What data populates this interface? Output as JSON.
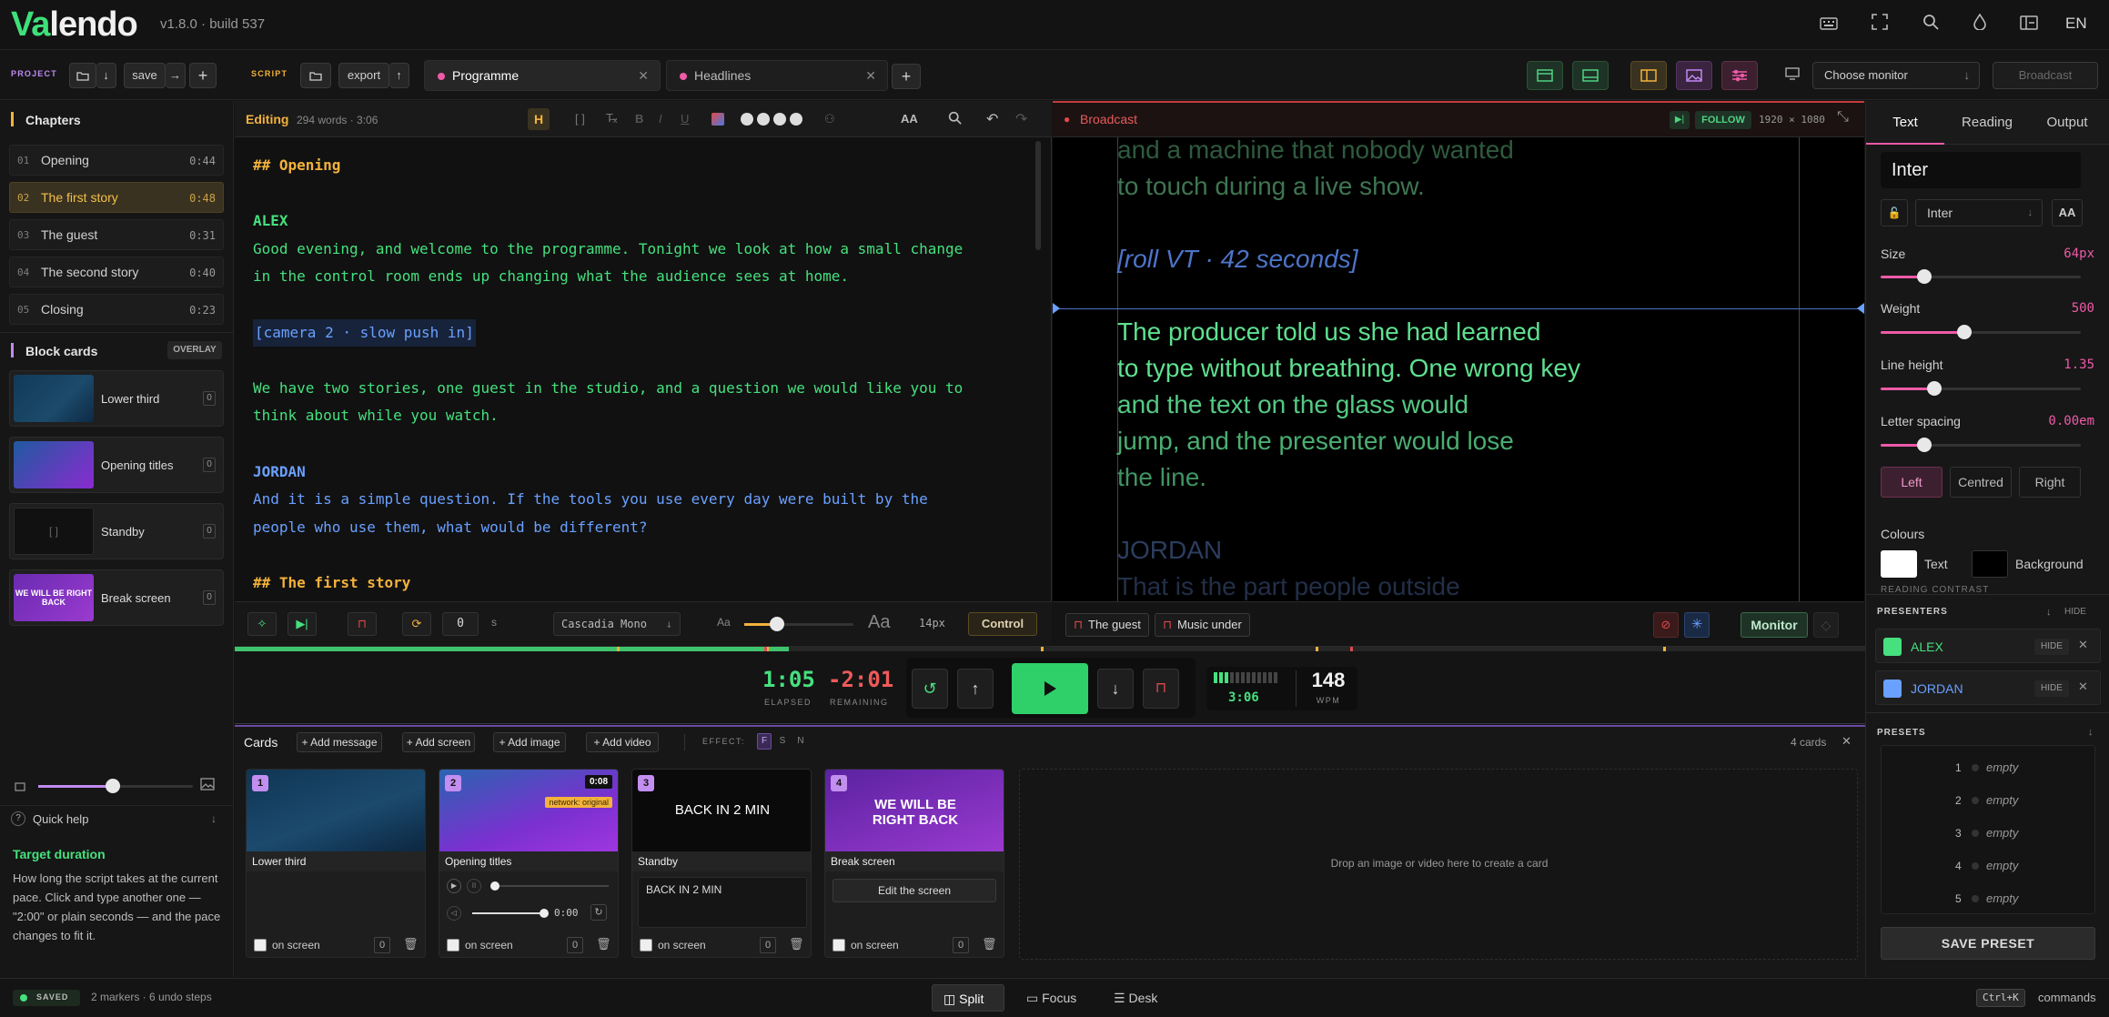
{
  "app": {
    "logo_a": "Va",
    "logo_b": "lendo",
    "version": "v1.8.0 · build 537",
    "lang": "EN"
  },
  "icons": {
    "top": [
      "keyboard-icon",
      "fullscreen-icon",
      "search-icon",
      "drop-icon",
      "layout-icon"
    ]
  },
  "toolbar": {
    "project_label": "PROJECT",
    "script_label": "SCRIPT",
    "save": "save",
    "export": "export",
    "plus": "+",
    "tabs": [
      {
        "label": "Programme",
        "active": true
      },
      {
        "label": "Headlines",
        "active": false
      }
    ],
    "monitor_placeholder": "Choose monitor",
    "broadcast": "Broadcast"
  },
  "chapters": {
    "title": "Chapters",
    "items": [
      {
        "num": "01",
        "title": "Opening",
        "dur": "0:44"
      },
      {
        "num": "02",
        "title": "The first story",
        "dur": "0:48",
        "active": true
      },
      {
        "num": "03",
        "title": "The guest",
        "dur": "0:31"
      },
      {
        "num": "04",
        "title": "The second story",
        "dur": "0:40"
      },
      {
        "num": "05",
        "title": "Closing",
        "dur": "0:23"
      }
    ]
  },
  "blockcards": {
    "title": "Block cards",
    "overlay": "OVERLAY",
    "items": [
      {
        "label": "Lower third",
        "key": "0"
      },
      {
        "label": "Opening titles",
        "key": "0"
      },
      {
        "label": "Standby",
        "key": "0"
      },
      {
        "label": "Break screen",
        "key": "0",
        "thumb_text": "WE WILL BE RIGHT BACK"
      }
    ]
  },
  "quickhelp": {
    "label": "Quick help",
    "title": "Target duration",
    "body": "How long the script takes at the current pace. Click and type another one — \"2:00\" or plain seconds — and the pace changes to fit it."
  },
  "editor": {
    "mode": "Editing",
    "meta": "294 words · 3:06",
    "caps": "AA",
    "lines": [
      {
        "t": "## Opening",
        "c": "#f3b23c",
        "b": true
      },
      {
        "t": "",
        "c": "#ccc"
      },
      {
        "t": "ALEX",
        "c": "#46e07e",
        "b": true
      },
      {
        "t": "Good evening, and welcome to the programme. Tonight we look at how a small change",
        "c": "#46e07e"
      },
      {
        "t": "in the control room ends up changing what the audience sees at home.",
        "c": "#46e07e"
      },
      {
        "t": "",
        "c": "#ccc"
      },
      {
        "t": "[camera 2 · slow push in]",
        "c": "#6aa0ff",
        "bg": true
      },
      {
        "t": "",
        "c": "#ccc"
      },
      {
        "t": "We have two stories, one guest in the studio, and a question we would like you to",
        "c": "#46e07e"
      },
      {
        "t": "think about while you watch.",
        "c": "#46e07e"
      },
      {
        "t": "",
        "c": "#ccc"
      },
      {
        "t": "JORDAN",
        "c": "#6aa0ff",
        "b": true
      },
      {
        "t": "And it is a simple question. If the tools you use every day were built by the",
        "c": "#6aa0ff"
      },
      {
        "t": "people who use them, what would be different?",
        "c": "#6aa0ff"
      },
      {
        "t": "",
        "c": "#ccc"
      },
      {
        "t": "## The first story",
        "c": "#f3b23c",
        "b": true
      }
    ],
    "foot": {
      "offset": "0",
      "unit": "s",
      "font": "Cascadia Mono",
      "aa_small": "Aa",
      "aa_big": "Aa",
      "size": "14px",
      "control": "Control",
      "slider": 0.3
    }
  },
  "broadcast": {
    "title": "Broadcast",
    "follow": "FOLLOW",
    "res": "1920 × 1080",
    "lines": [
      {
        "t": "and a machine that nobody wanted",
        "c": "#2f5a3e"
      },
      {
        "t": "to touch during a live show.",
        "c": "#3f7552"
      },
      {
        "t": "",
        "c": "#000"
      },
      {
        "t": "[roll VT · 42 seconds]",
        "c": "#4d74c8",
        "i": true
      },
      {
        "t": "",
        "c": "#000"
      },
      {
        "t": "The producer told us she had learned",
        "c": "#5fe090"
      },
      {
        "t": "to type without breathing. One wrong key",
        "c": "#5fe090"
      },
      {
        "t": "and the text on the glass would",
        "c": "#55c985"
      },
      {
        "t": "jump, and the presenter would lose",
        "c": "#4aae72"
      },
      {
        "t": "the line.",
        "c": "#3f9462"
      },
      {
        "t": "",
        "c": "#000"
      },
      {
        "t": "JORDAN",
        "c": "#2c3d5e"
      },
      {
        "t": "That is the part people outside",
        "c": "#232f48"
      }
    ],
    "chips": [
      "The guest",
      "Music under"
    ],
    "monitor": "Monitor"
  },
  "transport": {
    "elapsed": "1:05",
    "elapsed_label": "ELAPSED",
    "remaining": "-2:01",
    "remaining_label": "REMAINING",
    "total": "3:06",
    "wpm": "148",
    "wpm_label": "WPM",
    "progress": 0.34
  },
  "cards": {
    "title": "Cards",
    "add": [
      "+ Add message",
      "+ Add screen",
      "+ Add image",
      "+ Add video"
    ],
    "effect_label": "EFFECT:",
    "effects": [
      "F",
      "S",
      "N"
    ],
    "count": "4 cards",
    "drop": "Drop an image or video here to create a card",
    "items": [
      {
        "num": "1",
        "title": "Lower third",
        "z": "0",
        "on": "on screen"
      },
      {
        "num": "2",
        "title": "Opening titles",
        "z": "0",
        "on": "on screen",
        "badge": "0:08",
        "tag": "network: original",
        "time": "0:00"
      },
      {
        "num": "3",
        "title": "Standby",
        "z": "0",
        "on": "on screen",
        "img_text": "BACK IN 2 MIN",
        "field": "BACK IN 2 MIN"
      },
      {
        "num": "4",
        "title": "Break screen",
        "z": "0",
        "on": "on screen",
        "img_text": "WE WILL BE RIGHT BACK",
        "edit": "Edit the screen"
      }
    ]
  },
  "panel": {
    "tabs": [
      "Text",
      "Reading",
      "Output"
    ],
    "font_name": "Inter",
    "font_select": "Inter",
    "caps": "AA",
    "size": {
      "label": "Size",
      "value": "64px",
      "fill": 0.22
    },
    "weight": {
      "label": "Weight",
      "value": "500",
      "fill": 0.42
    },
    "lineheight": {
      "label": "Line height",
      "value": "1.35",
      "fill": 0.27
    },
    "letterspacing": {
      "label": "Letter spacing",
      "value": "0.00em",
      "fill": 0.22
    },
    "align": [
      "Left",
      "Centred",
      "Right"
    ],
    "colours": "Colours",
    "text_colour": "Text",
    "bg_colour": "Background",
    "reading_contrast": "READING CONTRAST",
    "presenters_label": "PRESENTERS",
    "hide": "HIDE",
    "presenters": [
      {
        "name": "ALEX",
        "color": "#46e07e"
      },
      {
        "name": "JORDAN",
        "color": "#6aa0ff"
      }
    ],
    "presets_label": "PRESETS",
    "presets": [
      "1",
      "2",
      "3",
      "4",
      "5"
    ],
    "empty": "empty",
    "save_preset": "SAVE PRESET"
  },
  "status": {
    "saved": "SAVED",
    "info": "2 markers · 6 undo steps",
    "views": [
      "Split",
      "Focus",
      "Desk"
    ],
    "shortcut": "Ctrl+K",
    "commands": "commands"
  }
}
